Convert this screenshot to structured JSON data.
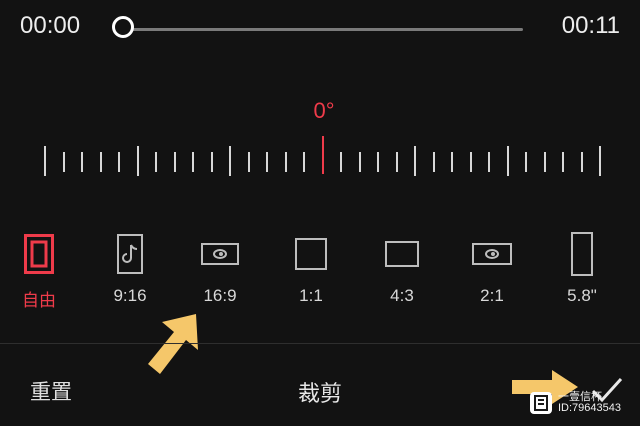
{
  "player": {
    "current_time": "00:00",
    "total_time": "00:11",
    "progress": 0
  },
  "rotation": {
    "angle_label": "0°"
  },
  "aspect_ratios": [
    {
      "label": "自由",
      "icon": "free-crop-icon",
      "selected": true
    },
    {
      "label": "9:16",
      "icon": "tiktok-portrait-icon",
      "selected": false
    },
    {
      "label": "16:9",
      "icon": "landscape-video-icon",
      "selected": false
    },
    {
      "label": "1:1",
      "icon": "square-icon",
      "selected": false
    },
    {
      "label": "4:3",
      "icon": "rectangle-4-3-icon",
      "selected": false
    },
    {
      "label": "2:1",
      "icon": "wide-video-icon",
      "selected": false
    },
    {
      "label": "5.8\"",
      "icon": "phone-portrait-icon",
      "selected": false
    }
  ],
  "bottom_bar": {
    "reset_label": "重置",
    "title": "裁剪",
    "confirm_icon": "checkmark-icon"
  },
  "watermark": {
    "line1": "一壹信杯",
    "line2": "ID:79643543"
  },
  "colors": {
    "background": "#121212",
    "accent_red": "#ef3b4a",
    "annotation_arrow": "#f5c76a"
  }
}
